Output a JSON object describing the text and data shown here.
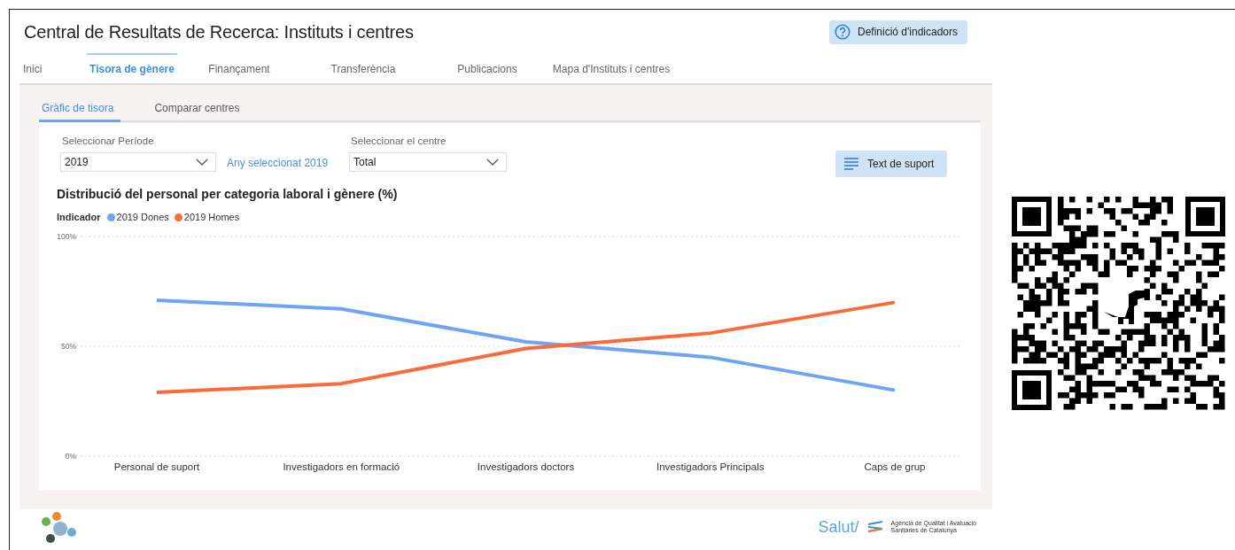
{
  "window": {
    "title": "Central de Resultats de Recerca: Instituts i centres"
  },
  "help_button": {
    "label": "Definició d'indicadors"
  },
  "tabs": [
    {
      "label": "Inici",
      "selected": false
    },
    {
      "label": "Tisora de gènere",
      "selected": true
    },
    {
      "label": "Finançament",
      "selected": false
    },
    {
      "label": "Transferència",
      "selected": false
    },
    {
      "label": "Publicacions",
      "selected": false
    },
    {
      "label": "Mapa d'Instituts i centres",
      "selected": false
    }
  ],
  "subtabs": [
    {
      "label": "Gràfic de tisora",
      "selected": true
    },
    {
      "label": "Comparar centres",
      "selected": false
    }
  ],
  "filters": [
    {
      "label": "Seleccionar Període",
      "value": "2019"
    },
    {
      "label": "Seleccionar el centre",
      "value": "Total"
    }
  ],
  "selected_year_note": "Any seleccionat 2019",
  "support_button": {
    "label": "Text de suport"
  },
  "chart": {
    "title": "Distribució del personal per categoria laboral i gènere (%)",
    "legend_title": "Indicador",
    "chart_data": {
      "type": "line",
      "categories": [
        "Personal de suport",
        "Investigadors en formació",
        "Investigadors doctors",
        "Investigadors Principals",
        "Caps de grup"
      ],
      "series": [
        {
          "name": "2019 Dones",
          "color": "#6fa3f5",
          "values": [
            71,
            67,
            52,
            45,
            30
          ]
        },
        {
          "name": "2019 Homes",
          "color": "#fa6b3c",
          "values": [
            29,
            33,
            49,
            56,
            70
          ]
        }
      ],
      "ylim": [
        0,
        100
      ],
      "yticks": [
        {
          "value": 0,
          "label": "0%"
        },
        {
          "value": 50,
          "label": "50%"
        },
        {
          "value": 100,
          "label": "100%"
        }
      ]
    }
  },
  "footer": {
    "brand": "Salut/",
    "agency_lines": [
      "Agència de Qualitat i Avaluació",
      "Sanitàries de Catalunya"
    ]
  }
}
